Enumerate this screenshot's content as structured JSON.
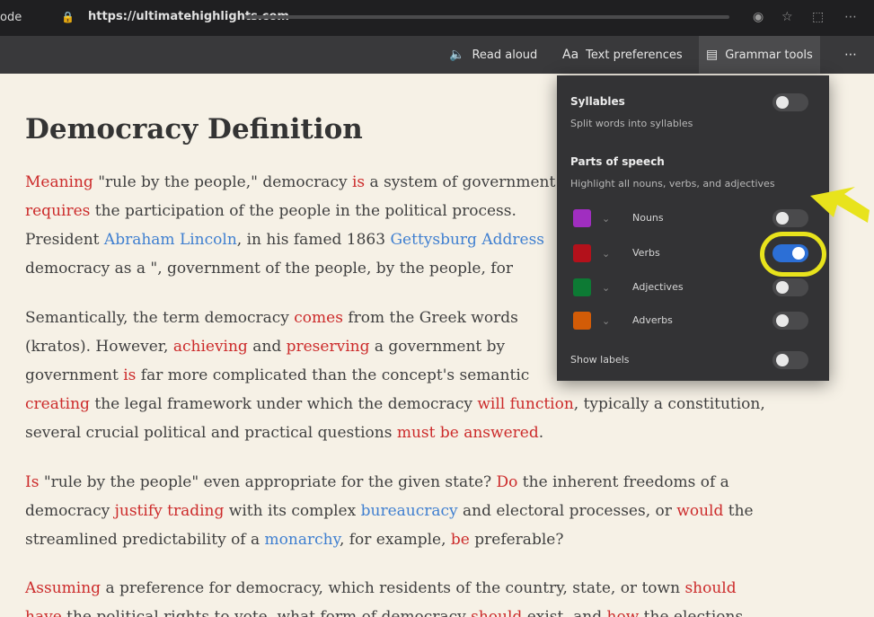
{
  "browser": {
    "left_fragment": "ode",
    "url": "https://ultimatehighlights.com",
    "icons": [
      "lock-icon",
      "profile-icon",
      "star-icon",
      "extensions-icon",
      "menu-icon"
    ]
  },
  "toolbar": {
    "read_aloud": "Read aloud",
    "text_preferences": "Text preferences",
    "grammar_tools": "Grammar tools",
    "more_icon": "ellipsis-icon"
  },
  "article": {
    "title": "Democracy Definition",
    "lines": [
      {
        "segments": [
          {
            "t": "Meaning",
            "c": "red"
          },
          {
            "t": " \"rule by the people,\" democracy "
          },
          {
            "t": "is",
            "c": "red"
          },
          {
            "t": " a system of government"
          }
        ]
      },
      {
        "segments": [
          {
            "t": "requires",
            "c": "red"
          },
          {
            "t": " the participation of the people in the political process. "
          }
        ]
      },
      {
        "segments": [
          {
            "t": "President "
          },
          {
            "t": "Abraham Lincoln",
            "c": "blue"
          },
          {
            "t": ", in his famed 1863 "
          },
          {
            "t": "Gettysburg Address",
            "c": "blue"
          }
        ]
      },
      {
        "segments": [
          {
            "t": "democracy as a \", government of the people, by the people, for"
          }
        ]
      },
      {
        "segments": [
          {
            "t": "Semantically, the term democracy "
          },
          {
            "t": "comes",
            "c": "red"
          },
          {
            "t": " from the Greek words"
          }
        ]
      },
      {
        "segments": [
          {
            "t": "(kratos). However, "
          },
          {
            "t": "achieving",
            "c": "red"
          },
          {
            "t": " and "
          },
          {
            "t": "preserving",
            "c": "red"
          },
          {
            "t": " a government by"
          }
        ]
      },
      {
        "segments": [
          {
            "t": "government "
          },
          {
            "t": "is",
            "c": "red"
          },
          {
            "t": " far more complicated than the concept's semantic"
          }
        ]
      },
      {
        "segments": [
          {
            "t": "creating",
            "c": "red"
          },
          {
            "t": " the legal framework under which the democracy "
          },
          {
            "t": "will function",
            "c": "red"
          },
          {
            "t": ", typically a constitution,"
          }
        ]
      },
      {
        "segments": [
          {
            "t": "several crucial political and practical questions "
          },
          {
            "t": "must be answered",
            "c": "red"
          },
          {
            "t": "."
          }
        ]
      },
      {
        "segments": [
          {
            "t": "Is",
            "c": "red"
          },
          {
            "t": " \"rule by the people\" even appropriate for the given state? "
          },
          {
            "t": "Do",
            "c": "red"
          },
          {
            "t": " the inherent freedoms of a"
          }
        ]
      },
      {
        "segments": [
          {
            "t": "democracy "
          },
          {
            "t": "justify trading",
            "c": "red"
          },
          {
            "t": " with its complex "
          },
          {
            "t": "bureaucracy",
            "c": "blue"
          },
          {
            "t": " and electoral processes, or "
          },
          {
            "t": "would",
            "c": "red"
          },
          {
            "t": " the"
          }
        ]
      },
      {
        "segments": [
          {
            "t": "streamlined predictability of a "
          },
          {
            "t": "monarchy",
            "c": "blue"
          },
          {
            "t": ", for example, "
          },
          {
            "t": "be",
            "c": "red"
          },
          {
            "t": " preferable?"
          }
        ]
      },
      {
        "segments": [
          {
            "t": "Assuming",
            "c": "red"
          },
          {
            "t": " a preference for democracy, which residents of the country, state, or town "
          },
          {
            "t": "should",
            "c": "red"
          }
        ]
      },
      {
        "segments": [
          {
            "t": "have",
            "c": "red"
          },
          {
            "t": " the political rights to vote, what form of democracy "
          },
          {
            "t": "should",
            "c": "red"
          },
          {
            "t": " exist, and "
          },
          {
            "t": "how",
            "c": "red"
          },
          {
            "t": " the elections"
          }
        ]
      }
    ]
  },
  "popover": {
    "syllables": {
      "title": "Syllables",
      "subtitle": "Split words into syllables",
      "on": false
    },
    "parts": {
      "title": "Parts of speech",
      "subtitle": "Highlight all nouns, verbs, and adjectives"
    },
    "rows": [
      {
        "label": "Nouns",
        "color": "#a02ec0",
        "on": false
      },
      {
        "label": "Verbs",
        "color": "#b3111b",
        "on": true
      },
      {
        "label": "Adjectives",
        "color": "#0d7a34",
        "on": false
      },
      {
        "label": "Adverbs",
        "color": "#d35c07",
        "on": false
      }
    ],
    "show_labels": {
      "label": "Show labels",
      "on": false
    }
  },
  "annotation_color": "#e8e31c"
}
